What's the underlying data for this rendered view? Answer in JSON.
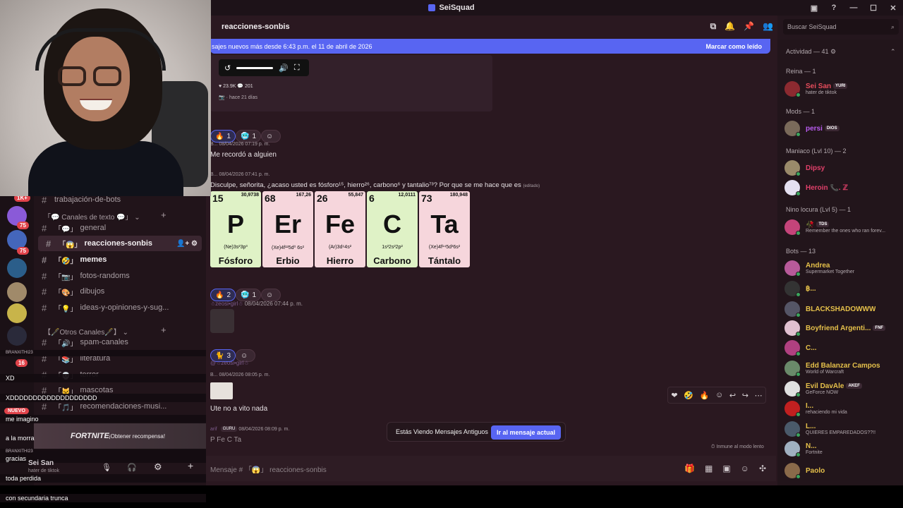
{
  "window": {
    "title": "SeiSquad"
  },
  "channel": {
    "name": "reacciones-sonbis",
    "composer_placeholder": "Mensaje # 「😱」 reacciones-sonbis"
  },
  "newbar": {
    "text": "sajes nuevos más desde 6:43 p.m. el 11 de abril de 2026",
    "action": "Marcar como leído"
  },
  "search": {
    "placeholder": "Buscar SeiSquad"
  },
  "embed": {
    "likes": "23.9K",
    "comments": "201",
    "ago": "hace 21 días"
  },
  "messages": [
    {
      "time": "08/04/2026 07:19 p. m.",
      "text": "Me recordó a alguien"
    },
    {
      "time": "08/04/2026 07:41 p. m.",
      "text": "Disculpe, señorita, ¿acaso usted es fósforo¹⁵, hierro²⁶, carbono⁶ y tantalio⁷³? Por que se me hace que es",
      "edited": "(editado)"
    },
    {
      "time": "08/04/2026 07:44 p. m.",
      "user": "☃zeosi•girl☃"
    },
    {
      "time": "08/04/2026 08:05 p. m.",
      "text": "Ute no a vito nada",
      "reply_user": "@☃zeosi•girl☃"
    },
    {
      "user": "arif",
      "badge": "GURU",
      "time": "08/04/2026 08:09 p. m.",
      "text": "P Fe C Ta"
    }
  ],
  "reactions": {
    "r1": [
      {
        "e": "🔥",
        "c": "1"
      },
      {
        "e": "🥶",
        "c": "1"
      },
      {
        "e": "☺",
        "c": ""
      }
    ],
    "r2": [
      {
        "e": "🔥",
        "c": "2"
      },
      {
        "e": "🥶",
        "c": "1"
      },
      {
        "e": "☺",
        "c": ""
      }
    ],
    "r3": [
      {
        "e": "🐈",
        "c": "3"
      },
      {
        "e": "☺",
        "c": ""
      }
    ]
  },
  "tiles": [
    {
      "num": "15",
      "mass": "30,9738",
      "sym": "P",
      "cfg": "(Ne)3s²3p³",
      "name": "Fósforo",
      "color": "#dff2c6"
    },
    {
      "num": "68",
      "mass": "167,26",
      "sym": "Er",
      "cfg": "(Xe)4f¹²5d⁰ 6s²",
      "name": "Erbio",
      "color": "#f6d6dc"
    },
    {
      "num": "26",
      "mass": "55,847",
      "sym": "Fe",
      "cfg": "(Ar)3d⁶4s²",
      "name": "Hierro",
      "color": "#f6d6dc"
    },
    {
      "num": "6",
      "mass": "12,0111",
      "sym": "C",
      "cfg": "1s²2s²2p²",
      "name": "Carbono",
      "color": "#dff2c6"
    },
    {
      "num": "73",
      "mass": "180,948",
      "sym": "Ta",
      "cfg": "(Xe)4f¹⁴5d³6s²",
      "name": "Tántalo",
      "color": "#f6d6dc"
    }
  ],
  "old_messages": {
    "text": "Estás Viendo Mensajes Antiguos",
    "button": "Ir al mensaje actual"
  },
  "slowmode": "Inmune al modo lento",
  "sidebar": {
    "cat_text": "「💬 Canales de texto 💬」",
    "cat_other": "【🖋️Otros Canales🖋️】",
    "channels": [
      "general",
      "reacciones-sonbis",
      "memes",
      "fotos-randoms",
      "dibujos",
      "ideas-y-opiniones-y-sug...",
      "spam-canales",
      "literatura",
      "terror",
      "mascotas",
      "recomendaciones-musi..."
    ],
    "partial": "trabajación-de-bots",
    "badges": {
      "b1": "1K+",
      "b2": "75",
      "b3": "75",
      "b4": "16"
    }
  },
  "overlay": [
    "XD",
    "XDDDDDDDDDDDDDDDDDDD",
    "NUEVO",
    "me imagino",
    "a la morra",
    "gracias",
    "toda perdida",
    "con secundaria trunca"
  ],
  "overlay_users": [
    "BRANXITHI23",
    "BRANXITHI23"
  ],
  "fortnite": {
    "logo": "FORTNITE",
    "cta": "¡Obtener recompensa!"
  },
  "user": {
    "name": "Sei San",
    "status": "hater de tiktok"
  },
  "members": {
    "activity": "Actividad — 41",
    "groups": [
      "Reina — 1",
      "Mods — 1",
      "Maniaco (Lvl 10) — 2",
      "Nino locura (Lvl 5) — 1",
      "Bots — 13"
    ],
    "list": [
      {
        "n": "Sei San",
        "tag": "YURI",
        "s": "hater de tiktok",
        "c": "#e84d5c"
      },
      {
        "n": "persi",
        "tag": "DIOS",
        "s": "",
        "c": "#b95cf0"
      },
      {
        "n": "Dipsy",
        "s": "",
        "c": "#e0406a"
      },
      {
        "n": "Heroin 📞. ℤ",
        "s": "",
        "c": "#e0406a"
      },
      {
        "n": "🥀",
        "tag": "TDS",
        "s": "Remember the ones who ran forev...",
        "c": "#e0406a"
      },
      {
        "n": "Andrea",
        "s": "Supermarket Together",
        "c": "#e5c04a"
      },
      {
        "n": "฿...",
        "s": "",
        "c": "#e5c04a"
      },
      {
        "n": "BLACKSHADOWWW",
        "s": "",
        "c": "#e5c04a"
      },
      {
        "n": "Boyfriend Argenti...",
        "tag": "FNF",
        "s": "",
        "c": "#e5c04a"
      },
      {
        "n": "C...",
        "s": "",
        "c": "#e5c04a"
      },
      {
        "n": "Edd Balanzar Campos",
        "s": "World of Warcraft",
        "c": "#e5c04a"
      },
      {
        "n": "Evil DavAle",
        "tag": "AKEF",
        "s": "GeForce NOW",
        "c": "#e5c04a"
      },
      {
        "n": "I...",
        "s": "rehaciendo mi vida",
        "c": "#e5c04a"
      },
      {
        "n": "L...",
        "s": "QUIERES EMPAREDADOS??!!",
        "c": "#e5c04a"
      },
      {
        "n": "N...",
        "s": "Fortnite",
        "c": "#e5c04a"
      },
      {
        "n": "Paolo",
        "s": "",
        "c": "#e5c04a"
      }
    ]
  }
}
